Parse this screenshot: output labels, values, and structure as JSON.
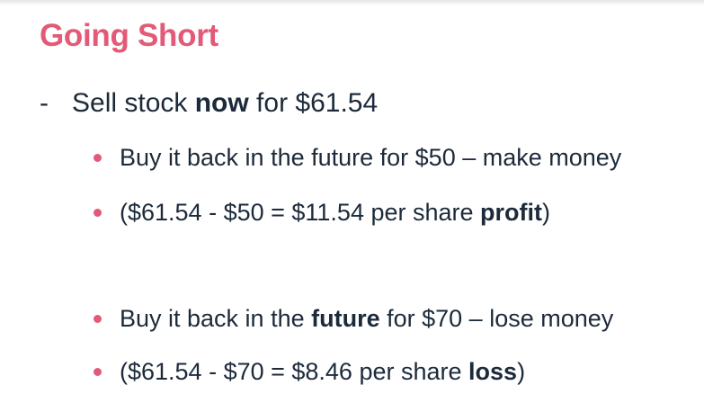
{
  "slide": {
    "title": "Going Short",
    "main_point": {
      "dash": "-",
      "pre": "Sell stock ",
      "bold": "now",
      "post": " for $61.54"
    },
    "bullets": [
      {
        "pre": "Buy it back in the future for $50 – make money",
        "bold": "",
        "post": ""
      },
      {
        "pre": "($61.54 - $50 = $11.54 per share ",
        "bold": "profit",
        "post": ")"
      },
      {
        "pre": "Buy it back in the ",
        "bold": "future",
        "post": " for $70 – lose money"
      },
      {
        "pre": "($61.54 - $70 = $8.46 per share ",
        "bold": "loss",
        "post": ")"
      }
    ],
    "colors": {
      "accent": "#e35a78",
      "text": "#1c2a3a"
    }
  }
}
